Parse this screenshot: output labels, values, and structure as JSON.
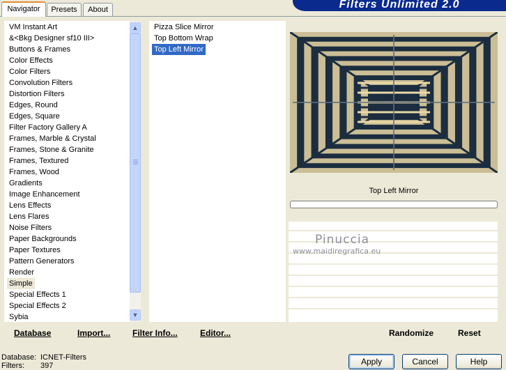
{
  "tabs": [
    "Navigator",
    "Presets",
    "About"
  ],
  "banner_title": "Filters Unlimited 2.0",
  "categories": [
    "VM Instant Art",
    "&<Bkg Designer sf10 III>",
    "Buttons & Frames",
    "Color Effects",
    "Color Filters",
    "Convolution Filters",
    "Distortion Filters",
    "Edges, Round",
    "Edges, Square",
    "Filter Factory Gallery A",
    "Frames, Marble & Crystal",
    "Frames, Stone & Granite",
    "Frames, Textured",
    "Frames, Wood",
    "Gradients",
    "Image Enhancement",
    "Lens Effects",
    "Lens Flares",
    "Noise Filters",
    "Paper Backgrounds",
    "Paper Textures",
    "Pattern Generators",
    "Render",
    "Simple",
    "Special Effects 1",
    "Special Effects 2",
    "Sybia"
  ],
  "selected_category": "Simple",
  "filters": [
    "Pizza Slice Mirror",
    "Top Bottom Wrap",
    "Top Left Mirror"
  ],
  "selected_filter": "Top Left Mirror",
  "preview": {
    "title": "Top Left Mirror",
    "colors": {
      "dark": "#1b2d3f",
      "light": "#ead8a6",
      "mid": "#5e6f7e"
    }
  },
  "watermark": {
    "name": "Pinuccia",
    "url": "www.maidiregrafica.eu"
  },
  "toolbar": {
    "database": "Database",
    "import": "Import...",
    "filter_info": "Filter Info...",
    "editor": "Editor...",
    "randomize": "Randomize",
    "reset": "Reset"
  },
  "status": {
    "database_label": "Database:",
    "database_value": "ICNET-Filters",
    "filters_label": "Filters:",
    "filters_value": "397"
  },
  "buttons": {
    "apply": "Apply",
    "cancel": "Cancel",
    "help": "Help"
  }
}
